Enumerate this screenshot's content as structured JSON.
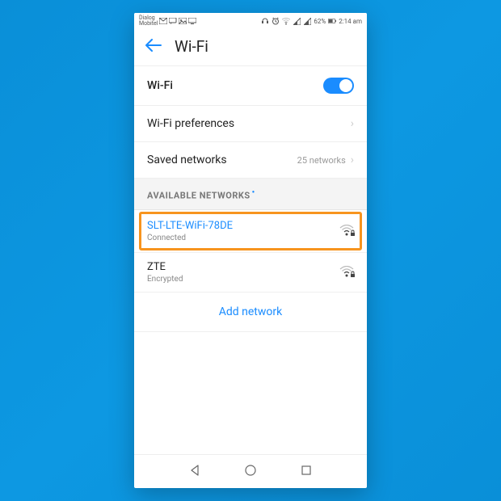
{
  "status": {
    "carrier": "Dialog\nMobitel",
    "battery": "62%",
    "time": "2:14 am"
  },
  "header": {
    "title": "Wi-Fi"
  },
  "rows": {
    "wifi_label": "Wi-Fi",
    "preferences_label": "Wi-Fi preferences",
    "saved_label": "Saved networks",
    "saved_count": "25 networks"
  },
  "section_header": "AVAILABLE NETWORKS",
  "networks": [
    {
      "name": "SLT-LTE-WiFi-78DE",
      "status": "Connected",
      "connected": true,
      "highlighted": true
    },
    {
      "name": "ZTE",
      "status": "Encrypted",
      "connected": false,
      "highlighted": false
    }
  ],
  "add_network": "Add network"
}
